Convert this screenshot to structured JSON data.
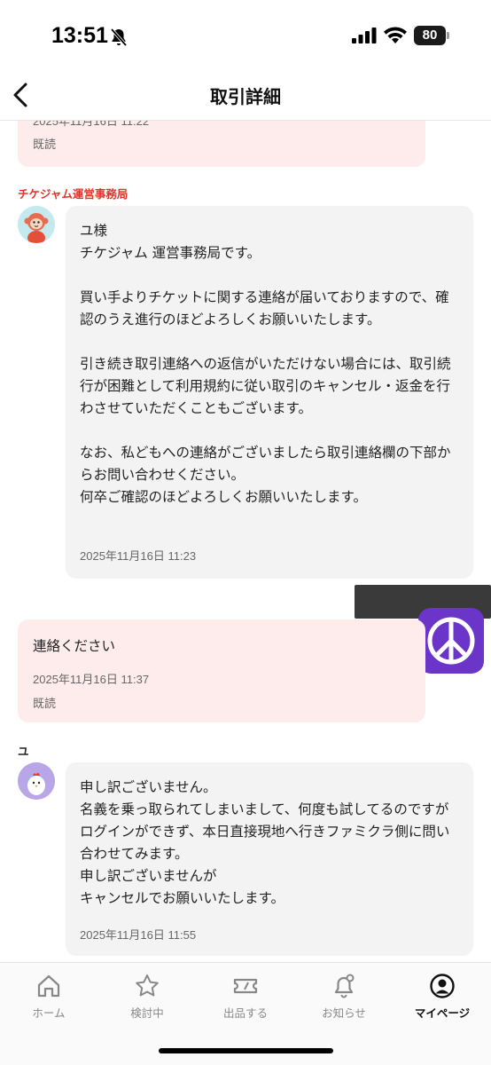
{
  "status_bar": {
    "time": "13:51",
    "battery": "80"
  },
  "header": {
    "title": "取引詳細"
  },
  "messages": {
    "m0": {
      "time": "2025年11月16日 11:22",
      "read": "既読"
    },
    "m1": {
      "sender": "チケジャム運営事務局",
      "text": "ユ様\nチケジャム 運営事務局です。\n\n買い手よりチケットに関する連絡が届いておりますので、確認のうえ進行のほどよろしくお願いいたします。\n\n引き続き取引連絡への返信がいただけない場合には、取引続行が困難として利用規約に従い取引のキャンセル・返金を行わさせていただくこともございます。\n\nなお、私どもへの連絡がございましたら取引連絡欄の下部からお問い合わせください。\n何卒ご確認のほどよろしくお願いいたします。",
      "time": "2025年11月16日 11:23"
    },
    "m2": {
      "text": "連絡ください",
      "time": "2025年11月16日 11:37",
      "read": "既読"
    },
    "m3": {
      "sender": "ユ",
      "text": "申し訳ございません。\n名義を乗っ取られてしまいまして、何度も試してるのですがログインができず、本日直接現地へ行きファミクラ側に問い合わせてみます。\n申し訳ございませんが\nキャンセルでお願いいたします。",
      "time": "2025年11月16日 11:55"
    }
  },
  "tabs": [
    {
      "label": "ホーム",
      "icon": "home-icon"
    },
    {
      "label": "検討中",
      "icon": "star-icon"
    },
    {
      "label": "出品する",
      "icon": "ticket-icon"
    },
    {
      "label": "お知らせ",
      "icon": "bell-icon"
    },
    {
      "label": "マイページ",
      "icon": "profile-icon"
    }
  ],
  "colors": {
    "accent": "#e0342b",
    "pink_bubble": "#fdeceb",
    "grey_bubble": "#f3f3f3",
    "peace_sticker": "#6a35c8"
  }
}
